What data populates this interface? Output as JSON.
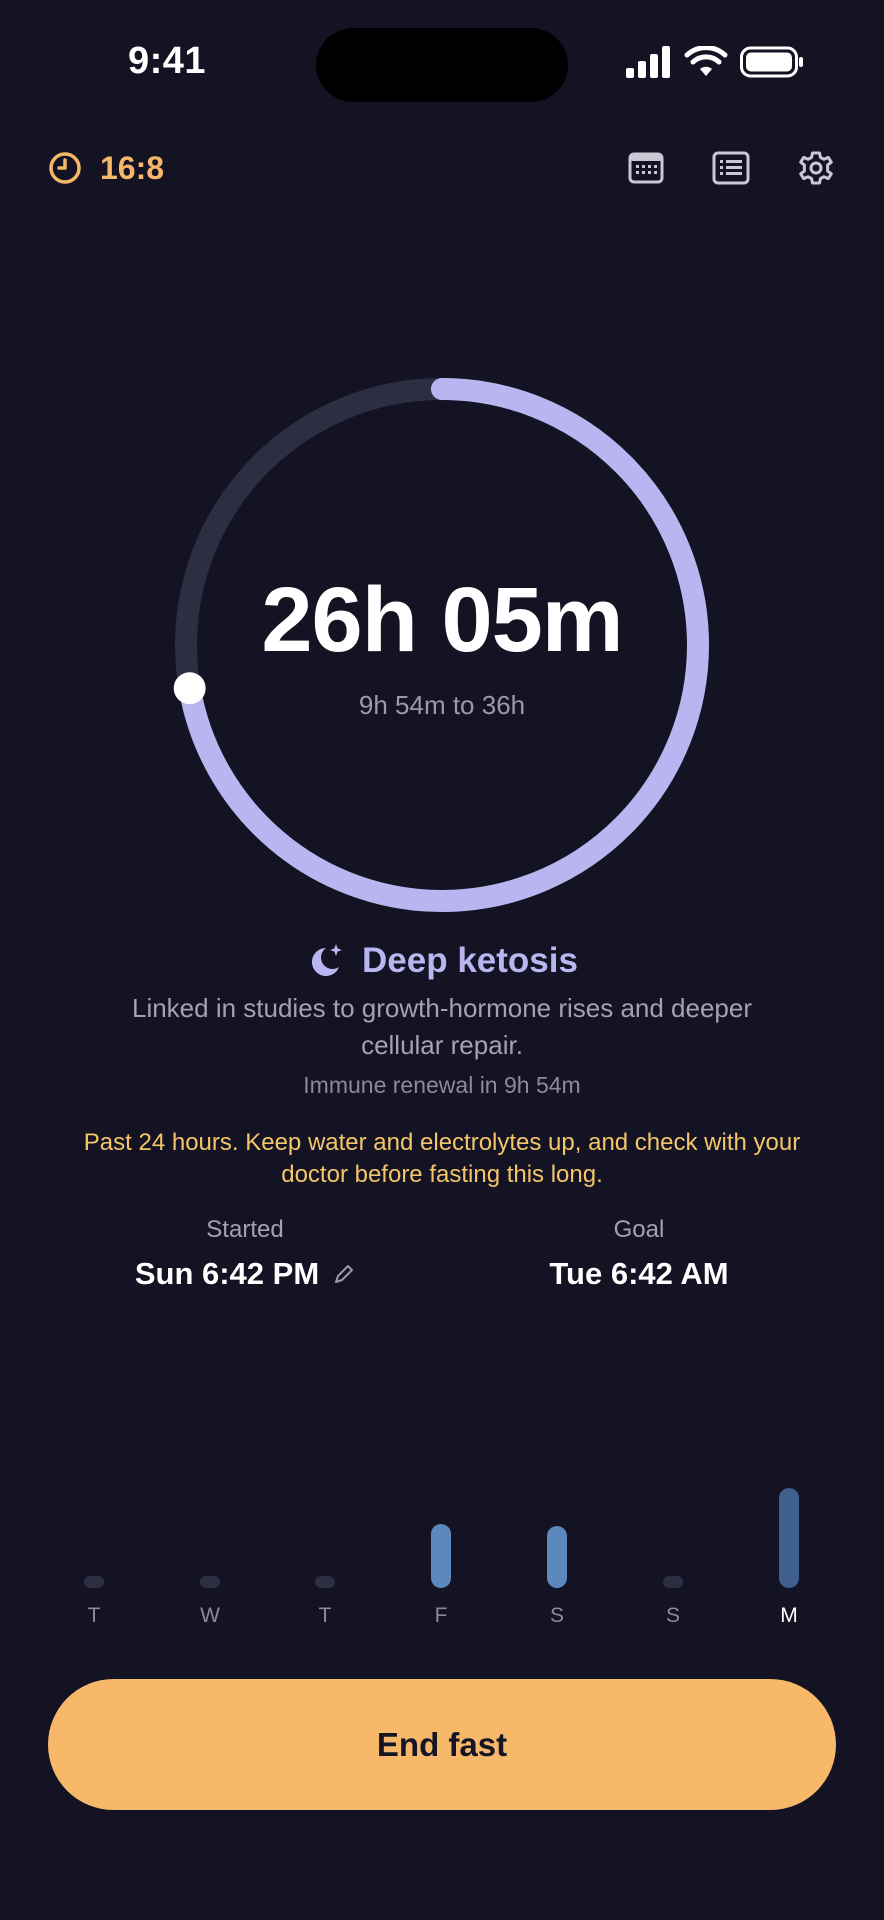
{
  "status_bar": {
    "time": "9:41",
    "icons": [
      "cellular-signal-icon",
      "wifi-icon",
      "battery-icon"
    ]
  },
  "header": {
    "protocol_label": "16:8",
    "protocol_icon": "clock-icon",
    "actions": [
      "calendar-icon",
      "journal-icon",
      "gear-icon"
    ],
    "accent_color": "#f5b76a"
  },
  "timer": {
    "elapsed": "26h 05m",
    "remaining": "9h 54m to 36h",
    "progress": 0.723,
    "progress_color": "#b9b5f0",
    "track_color": "#2e2e42"
  },
  "stage": {
    "icon": "moon-sparkle-icon",
    "title": "Deep ketosis",
    "description": "Linked in studies to growth-hormone rises and deeper cellular repair.",
    "next": "Immune renewal in 9h 54m"
  },
  "warning": "Past 24 hours. Keep water and electrolytes up, and check with your doctor before fasting this long.",
  "times": {
    "started_label": "Started",
    "started_value": "Sun 6:42 PM",
    "goal_label": "Goal",
    "goal_value": "Tue 6:42 AM"
  },
  "week": {
    "days": [
      {
        "label": "T",
        "level": 0.0,
        "current": false
      },
      {
        "label": "W",
        "level": 0.0,
        "current": false
      },
      {
        "label": "T",
        "level": 0.0,
        "current": false
      },
      {
        "label": "F",
        "level": 0.64,
        "current": false
      },
      {
        "label": "S",
        "level": 0.62,
        "current": false
      },
      {
        "label": "S",
        "level": 0.0,
        "current": false
      },
      {
        "label": "M",
        "level": 1.0,
        "current": true
      }
    ],
    "bar_color": "#5d88bd",
    "current_bar_color": "#3f5f8e",
    "empty_color": "#2e2e42"
  },
  "action": {
    "end_label": "End fast",
    "button_color": "#f7b86a"
  }
}
